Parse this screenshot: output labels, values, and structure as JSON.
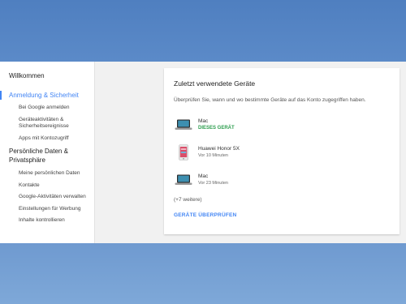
{
  "sidebar": {
    "welcome": "Willkommen",
    "section_security": "Anmeldung & Sicherheit",
    "security_items": [
      {
        "label": "Bei Google anmelden"
      },
      {
        "label": "Geräteaktivitäten & Sicherheitsereignisse"
      },
      {
        "label": "Apps mit Kontozugriff"
      }
    ],
    "section_privacy": "Persönliche Daten & Privatsphäre",
    "privacy_items": [
      {
        "label": "Meine persönlichen Daten"
      },
      {
        "label": "Kontakte"
      },
      {
        "label": "Google-Aktivitäten verwalten"
      },
      {
        "label": "Einstellungen für Werbung"
      },
      {
        "label": "Inhalte kontrollieren"
      }
    ]
  },
  "card": {
    "title": "Zuletzt verwendete Geräte",
    "description": "Überprüfen Sie, wann und wo bestimmte Geräte auf das Konto zugegriffen haben.",
    "devices": [
      {
        "name": "Mac",
        "status": "DIESES GERÄT",
        "icon": "laptop-icon"
      },
      {
        "name": "Huawei Honor 5X",
        "status": "Vor 10 Minuten",
        "icon": "phone-icon"
      },
      {
        "name": "Mac",
        "status": "Vor 23 Minuten",
        "icon": "laptop-icon"
      }
    ],
    "more": "(+7 weitere)",
    "check_button": "GERÄTE ÜBERPRÜFEN"
  },
  "colors": {
    "accent": "#4285f4",
    "current_device": "#2e9e4f",
    "background": "#5b8ac8"
  }
}
